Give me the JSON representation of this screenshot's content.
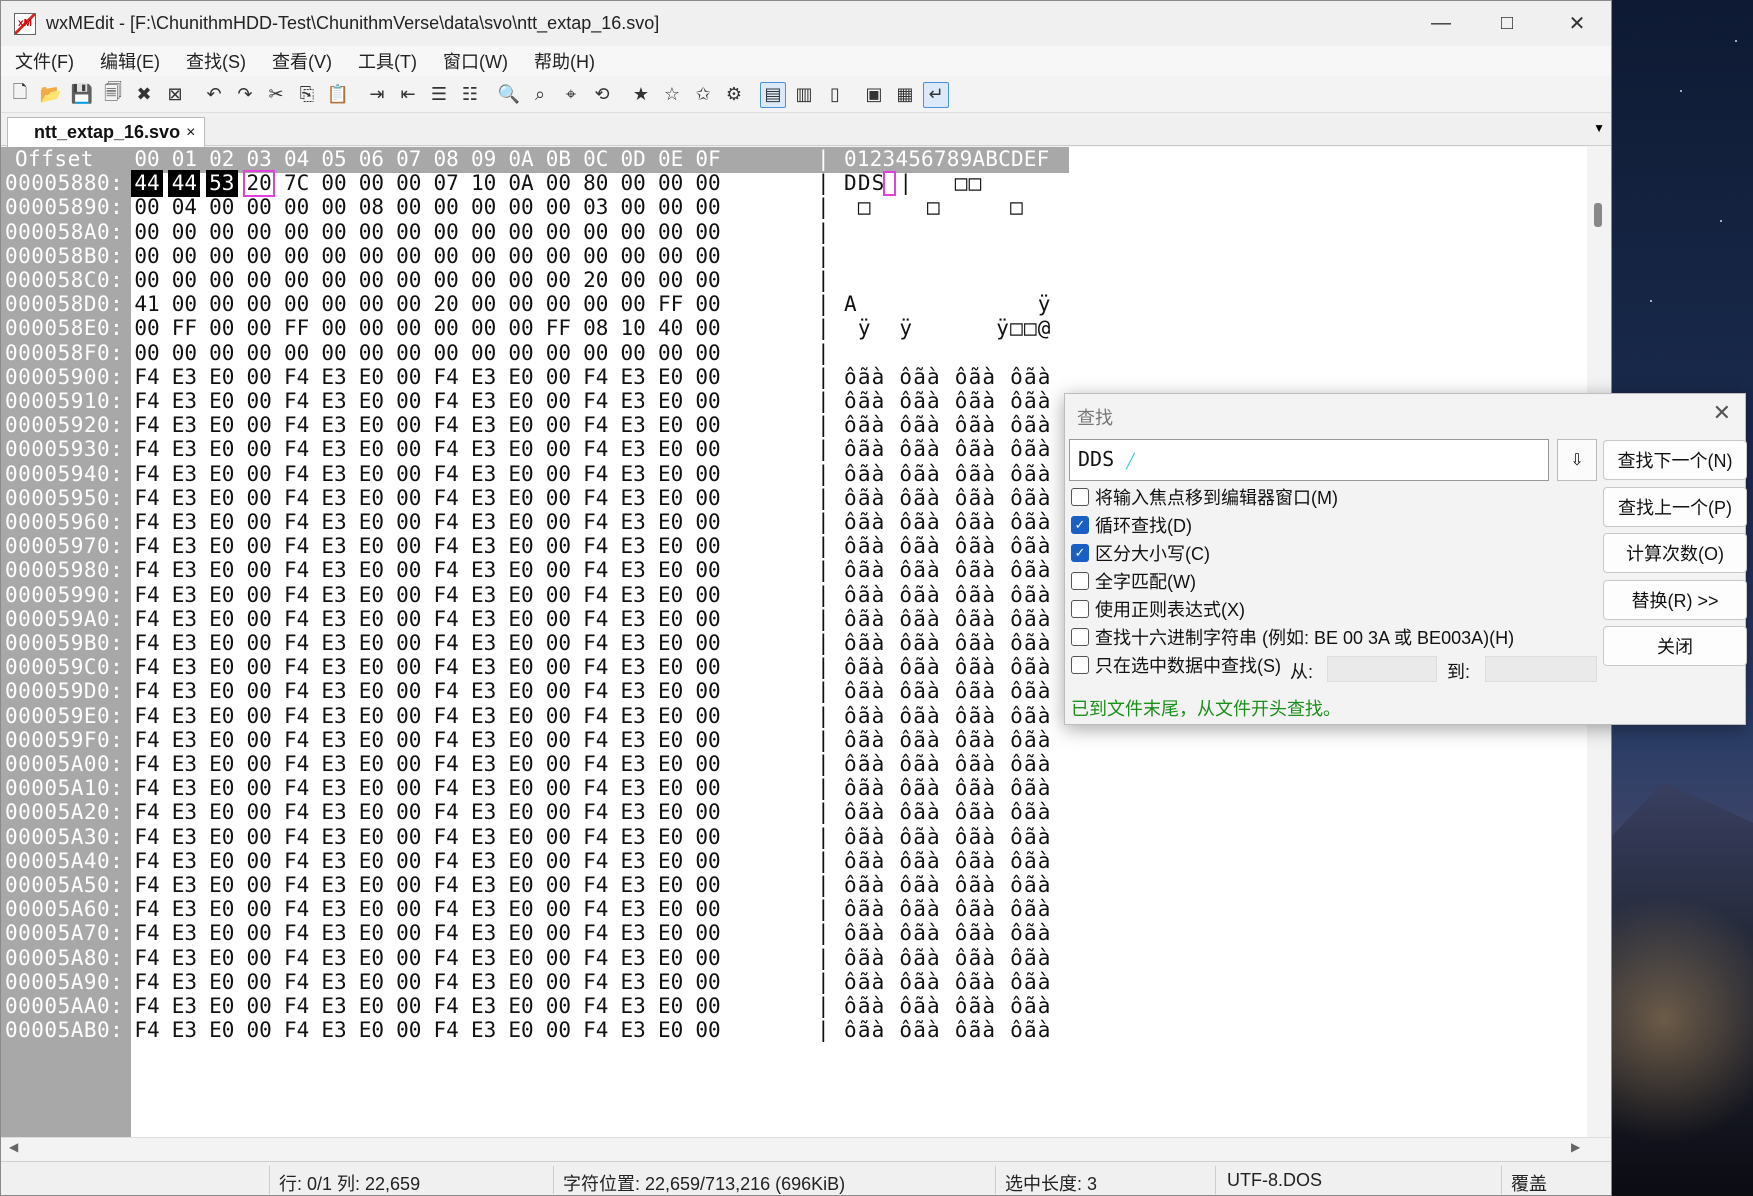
{
  "window": {
    "title": "wxMEdit - [F:\\ChunithmHDD-Test\\ChunithmVerse\\data\\svo\\ntt_extap_16.svo]",
    "icon": "app-icon"
  },
  "menu": [
    "文件(F)",
    "编辑(E)",
    "查找(S)",
    "查看(V)",
    "工具(T)",
    "窗口(W)",
    "帮助(H)"
  ],
  "toolbar_icons": [
    "new-file-icon",
    "open-file-icon",
    "save-icon",
    "save-all-icon",
    "close-file-icon",
    "close-all-icon",
    "undo-icon",
    "redo-icon",
    "cut-icon",
    "copy-icon",
    "paste-icon",
    "indent-icon",
    "unindent-icon",
    "comment-icon",
    "uncomment-icon",
    "find-icon",
    "find-next-icon",
    "find-prev-icon",
    "replace-icon",
    "bookmark-icon",
    "next-bookmark-icon",
    "prev-bookmark-icon",
    "settings-icon",
    "text-mode-icon",
    "column-mode-icon",
    "hex-mode-icon",
    "page-icon",
    "print-preview-icon",
    "word-wrap-icon"
  ],
  "tab": {
    "label": "ntt_extap_16.svo",
    "close": "×"
  },
  "editor": {
    "header": {
      "offset": "Offset",
      "cols": [
        "00",
        "01",
        "02",
        "03",
        "04",
        "05",
        "06",
        "07",
        "08",
        "09",
        "0A",
        "0B",
        "0C",
        "0D",
        "0E",
        "0F"
      ],
      "sep": "|",
      "ascii": "0123456789ABCDEF"
    },
    "rows": [
      {
        "off": "00005880:",
        "hex": [
          "44",
          "44",
          "53",
          "20",
          "7C",
          "00",
          "00",
          "00",
          "07",
          "10",
          "0A",
          "00",
          "80",
          "00",
          "00",
          "00"
        ],
        "ascii": "DDS |   □□"
      },
      {
        "off": "00005890:",
        "hex": [
          "00",
          "04",
          "00",
          "00",
          "00",
          "00",
          "08",
          "00",
          "00",
          "00",
          "00",
          "00",
          "03",
          "00",
          "00",
          "00"
        ],
        "ascii": " □    □     □"
      },
      {
        "off": "000058A0:",
        "hex": [
          "00",
          "00",
          "00",
          "00",
          "00",
          "00",
          "00",
          "00",
          "00",
          "00",
          "00",
          "00",
          "00",
          "00",
          "00",
          "00"
        ],
        "ascii": ""
      },
      {
        "off": "000058B0:",
        "hex": [
          "00",
          "00",
          "00",
          "00",
          "00",
          "00",
          "00",
          "00",
          "00",
          "00",
          "00",
          "00",
          "00",
          "00",
          "00",
          "00"
        ],
        "ascii": ""
      },
      {
        "off": "000058C0:",
        "hex": [
          "00",
          "00",
          "00",
          "00",
          "00",
          "00",
          "00",
          "00",
          "00",
          "00",
          "00",
          "00",
          "20",
          "00",
          "00",
          "00"
        ],
        "ascii": ""
      },
      {
        "off": "000058D0:",
        "hex": [
          "41",
          "00",
          "00",
          "00",
          "00",
          "00",
          "00",
          "00",
          "20",
          "00",
          "00",
          "00",
          "00",
          "00",
          "FF",
          "00"
        ],
        "ascii": "A             ÿ"
      },
      {
        "off": "000058E0:",
        "hex": [
          "00",
          "FF",
          "00",
          "00",
          "FF",
          "00",
          "00",
          "00",
          "00",
          "00",
          "00",
          "FF",
          "08",
          "10",
          "40",
          "00"
        ],
        "ascii": " ÿ  ÿ      ÿ□□@"
      },
      {
        "off": "000058F0:",
        "hex": [
          "00",
          "00",
          "00",
          "00",
          "00",
          "00",
          "00",
          "00",
          "00",
          "00",
          "00",
          "00",
          "00",
          "00",
          "00",
          "00"
        ],
        "ascii": ""
      },
      {
        "off": "00005900:",
        "fill": true
      },
      {
        "off": "00005910:",
        "fill": true
      },
      {
        "off": "00005920:",
        "fill": true
      },
      {
        "off": "00005930:",
        "fill": true
      },
      {
        "off": "00005940:",
        "fill": true
      },
      {
        "off": "00005950:",
        "fill": true
      },
      {
        "off": "00005960:",
        "fill": true
      },
      {
        "off": "00005970:",
        "fill": true
      },
      {
        "off": "00005980:",
        "fill": true
      },
      {
        "off": "00005990:",
        "fill": true
      },
      {
        "off": "000059A0:",
        "fill": true
      },
      {
        "off": "000059B0:",
        "fill": true
      },
      {
        "off": "000059C0:",
        "fill": true
      },
      {
        "off": "000059D0:",
        "fill": true
      },
      {
        "off": "000059E0:",
        "fill": true
      },
      {
        "off": "000059F0:",
        "fill": true
      },
      {
        "off": "00005A00:",
        "fill": true
      },
      {
        "off": "00005A10:",
        "fill": true
      },
      {
        "off": "00005A20:",
        "fill": true
      },
      {
        "off": "00005A30:",
        "fill": true
      },
      {
        "off": "00005A40:",
        "fill": true
      },
      {
        "off": "00005A50:",
        "fill": true
      },
      {
        "off": "00005A60:",
        "fill": true
      },
      {
        "off": "00005A70:",
        "fill": true
      },
      {
        "off": "00005A80:",
        "fill": true
      },
      {
        "off": "00005A90:",
        "fill": true
      },
      {
        "off": "00005AA0:",
        "fill": true
      },
      {
        "off": "00005AB0:",
        "fill": true
      }
    ],
    "fill_hex": [
      "F4",
      "E3",
      "E0",
      "00",
      "F4",
      "E3",
      "E0",
      "00",
      "F4",
      "E3",
      "E0",
      "00",
      "F4",
      "E3",
      "E0",
      "00"
    ],
    "fill_ascii": "ôãà ôãà ôãà ôãà"
  },
  "status": {
    "line": "行: 0/1 列: 22,659",
    "charpos": "字符位置: 22,659/713,216 (696KiB)",
    "sel": "选中长度: 3",
    "enc": "UTF-8.DOS",
    "mode": "覆盖"
  },
  "find_dialog": {
    "title": "查找",
    "query": "DDS ",
    "buttons": [
      "查找下一个(N)",
      "查找上一个(P)",
      "计算次数(O)",
      "替换(R) >>",
      "关闭"
    ],
    "options": [
      {
        "label": "将输入焦点移到编辑器窗口(M)",
        "checked": false
      },
      {
        "label": "循环查找(D)",
        "checked": true
      },
      {
        "label": "区分大小写(C)",
        "checked": true
      },
      {
        "label": "全字匹配(W)",
        "checked": false
      },
      {
        "label": "使用正则表达式(X)",
        "checked": false
      },
      {
        "label": "查找十六进制字符串 (例如: BE 00 3A 或 BE003A)(H)",
        "checked": false
      },
      {
        "label": "只在选中数据中查找(S)",
        "checked": false
      }
    ],
    "from_label": "从:",
    "to_label": "到:",
    "message": "已到文件末尾，从文件开头查找。"
  }
}
